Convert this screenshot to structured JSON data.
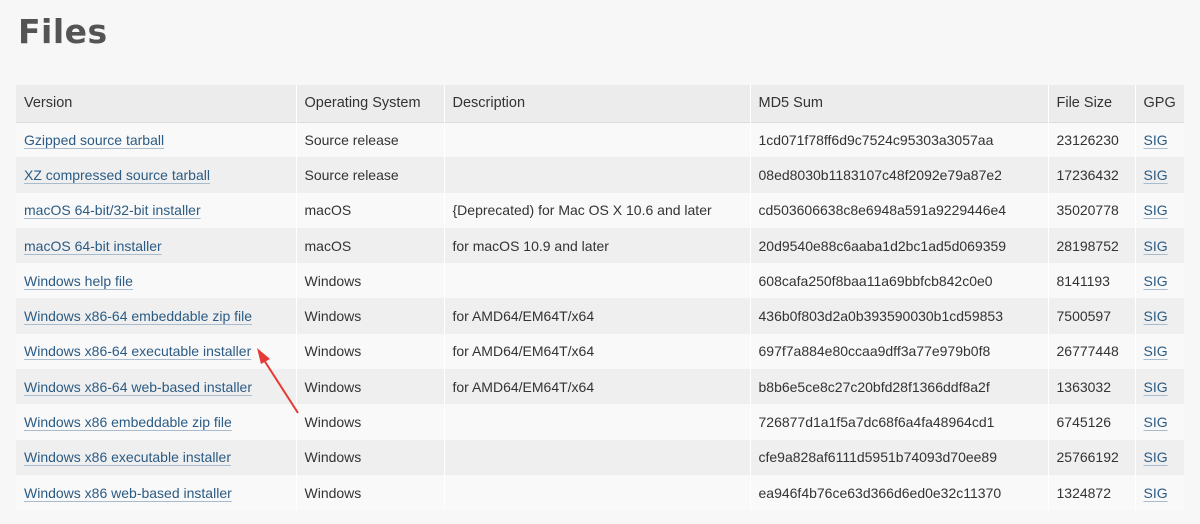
{
  "page": {
    "title": "Files"
  },
  "table": {
    "headers": {
      "version": "Version",
      "os": "Operating System",
      "description": "Description",
      "md5": "MD5 Sum",
      "size": "File Size",
      "gpg": "GPG"
    },
    "rows": [
      {
        "version": "Gzipped source tarball",
        "os": "Source release",
        "description": "",
        "md5": "1cd071f78ff6d9c7524c95303a3057aa",
        "size": "23126230",
        "gpg": "SIG"
      },
      {
        "version": "XZ compressed source tarball",
        "os": "Source release",
        "description": "",
        "md5": "08ed8030b1183107c48f2092e79a87e2",
        "size": "17236432",
        "gpg": "SIG"
      },
      {
        "version": "macOS 64-bit/32-bit installer",
        "os": "macOS",
        "description": "{Deprecated) for Mac OS X 10.6 and later",
        "md5": "cd503606638c8e6948a591a9229446e4",
        "size": "35020778",
        "gpg": "SIG"
      },
      {
        "version": "macOS 64-bit installer",
        "os": "macOS",
        "description": "for macOS 10.9 and later",
        "md5": "20d9540e88c6aaba1d2bc1ad5d069359",
        "size": "28198752",
        "gpg": "SIG"
      },
      {
        "version": "Windows help file",
        "os": "Windows",
        "description": "",
        "md5": "608cafa250f8baa11a69bbfcb842c0e0",
        "size": "8141193",
        "gpg": "SIG"
      },
      {
        "version": "Windows x86-64 embeddable zip file",
        "os": "Windows",
        "description": "for AMD64/EM64T/x64",
        "md5": "436b0f803d2a0b393590030b1cd59853",
        "size": "7500597",
        "gpg": "SIG"
      },
      {
        "version": "Windows x86-64 executable installer",
        "os": "Windows",
        "description": "for AMD64/EM64T/x64",
        "md5": "697f7a884e80ccaa9dff3a77e979b0f8",
        "size": "26777448",
        "gpg": "SIG"
      },
      {
        "version": "Windows x86-64 web-based installer",
        "os": "Windows",
        "description": "for AMD64/EM64T/x64",
        "md5": "b8b6e5ce8c27c20bfd28f1366ddf8a2f",
        "size": "1363032",
        "gpg": "SIG"
      },
      {
        "version": "Windows x86 embeddable zip file",
        "os": "Windows",
        "description": "",
        "md5": "726877d1a1f5a7dc68f6a4fa48964cd1",
        "size": "6745126",
        "gpg": "SIG"
      },
      {
        "version": "Windows x86 executable installer",
        "os": "Windows",
        "description": "",
        "md5": "cfe9a828af6111d5951b74093d70ee89",
        "size": "25766192",
        "gpg": "SIG"
      },
      {
        "version": "Windows x86 web-based installer",
        "os": "Windows",
        "description": "",
        "md5": "ea946f4b76ce63d366d6ed0e32c11370",
        "size": "1324872",
        "gpg": "SIG"
      }
    ]
  },
  "annotation": {
    "icon": "red-arrow-icon",
    "color": "#e53935"
  },
  "colors": {
    "link": "#2b5b84",
    "title": "#545454"
  }
}
